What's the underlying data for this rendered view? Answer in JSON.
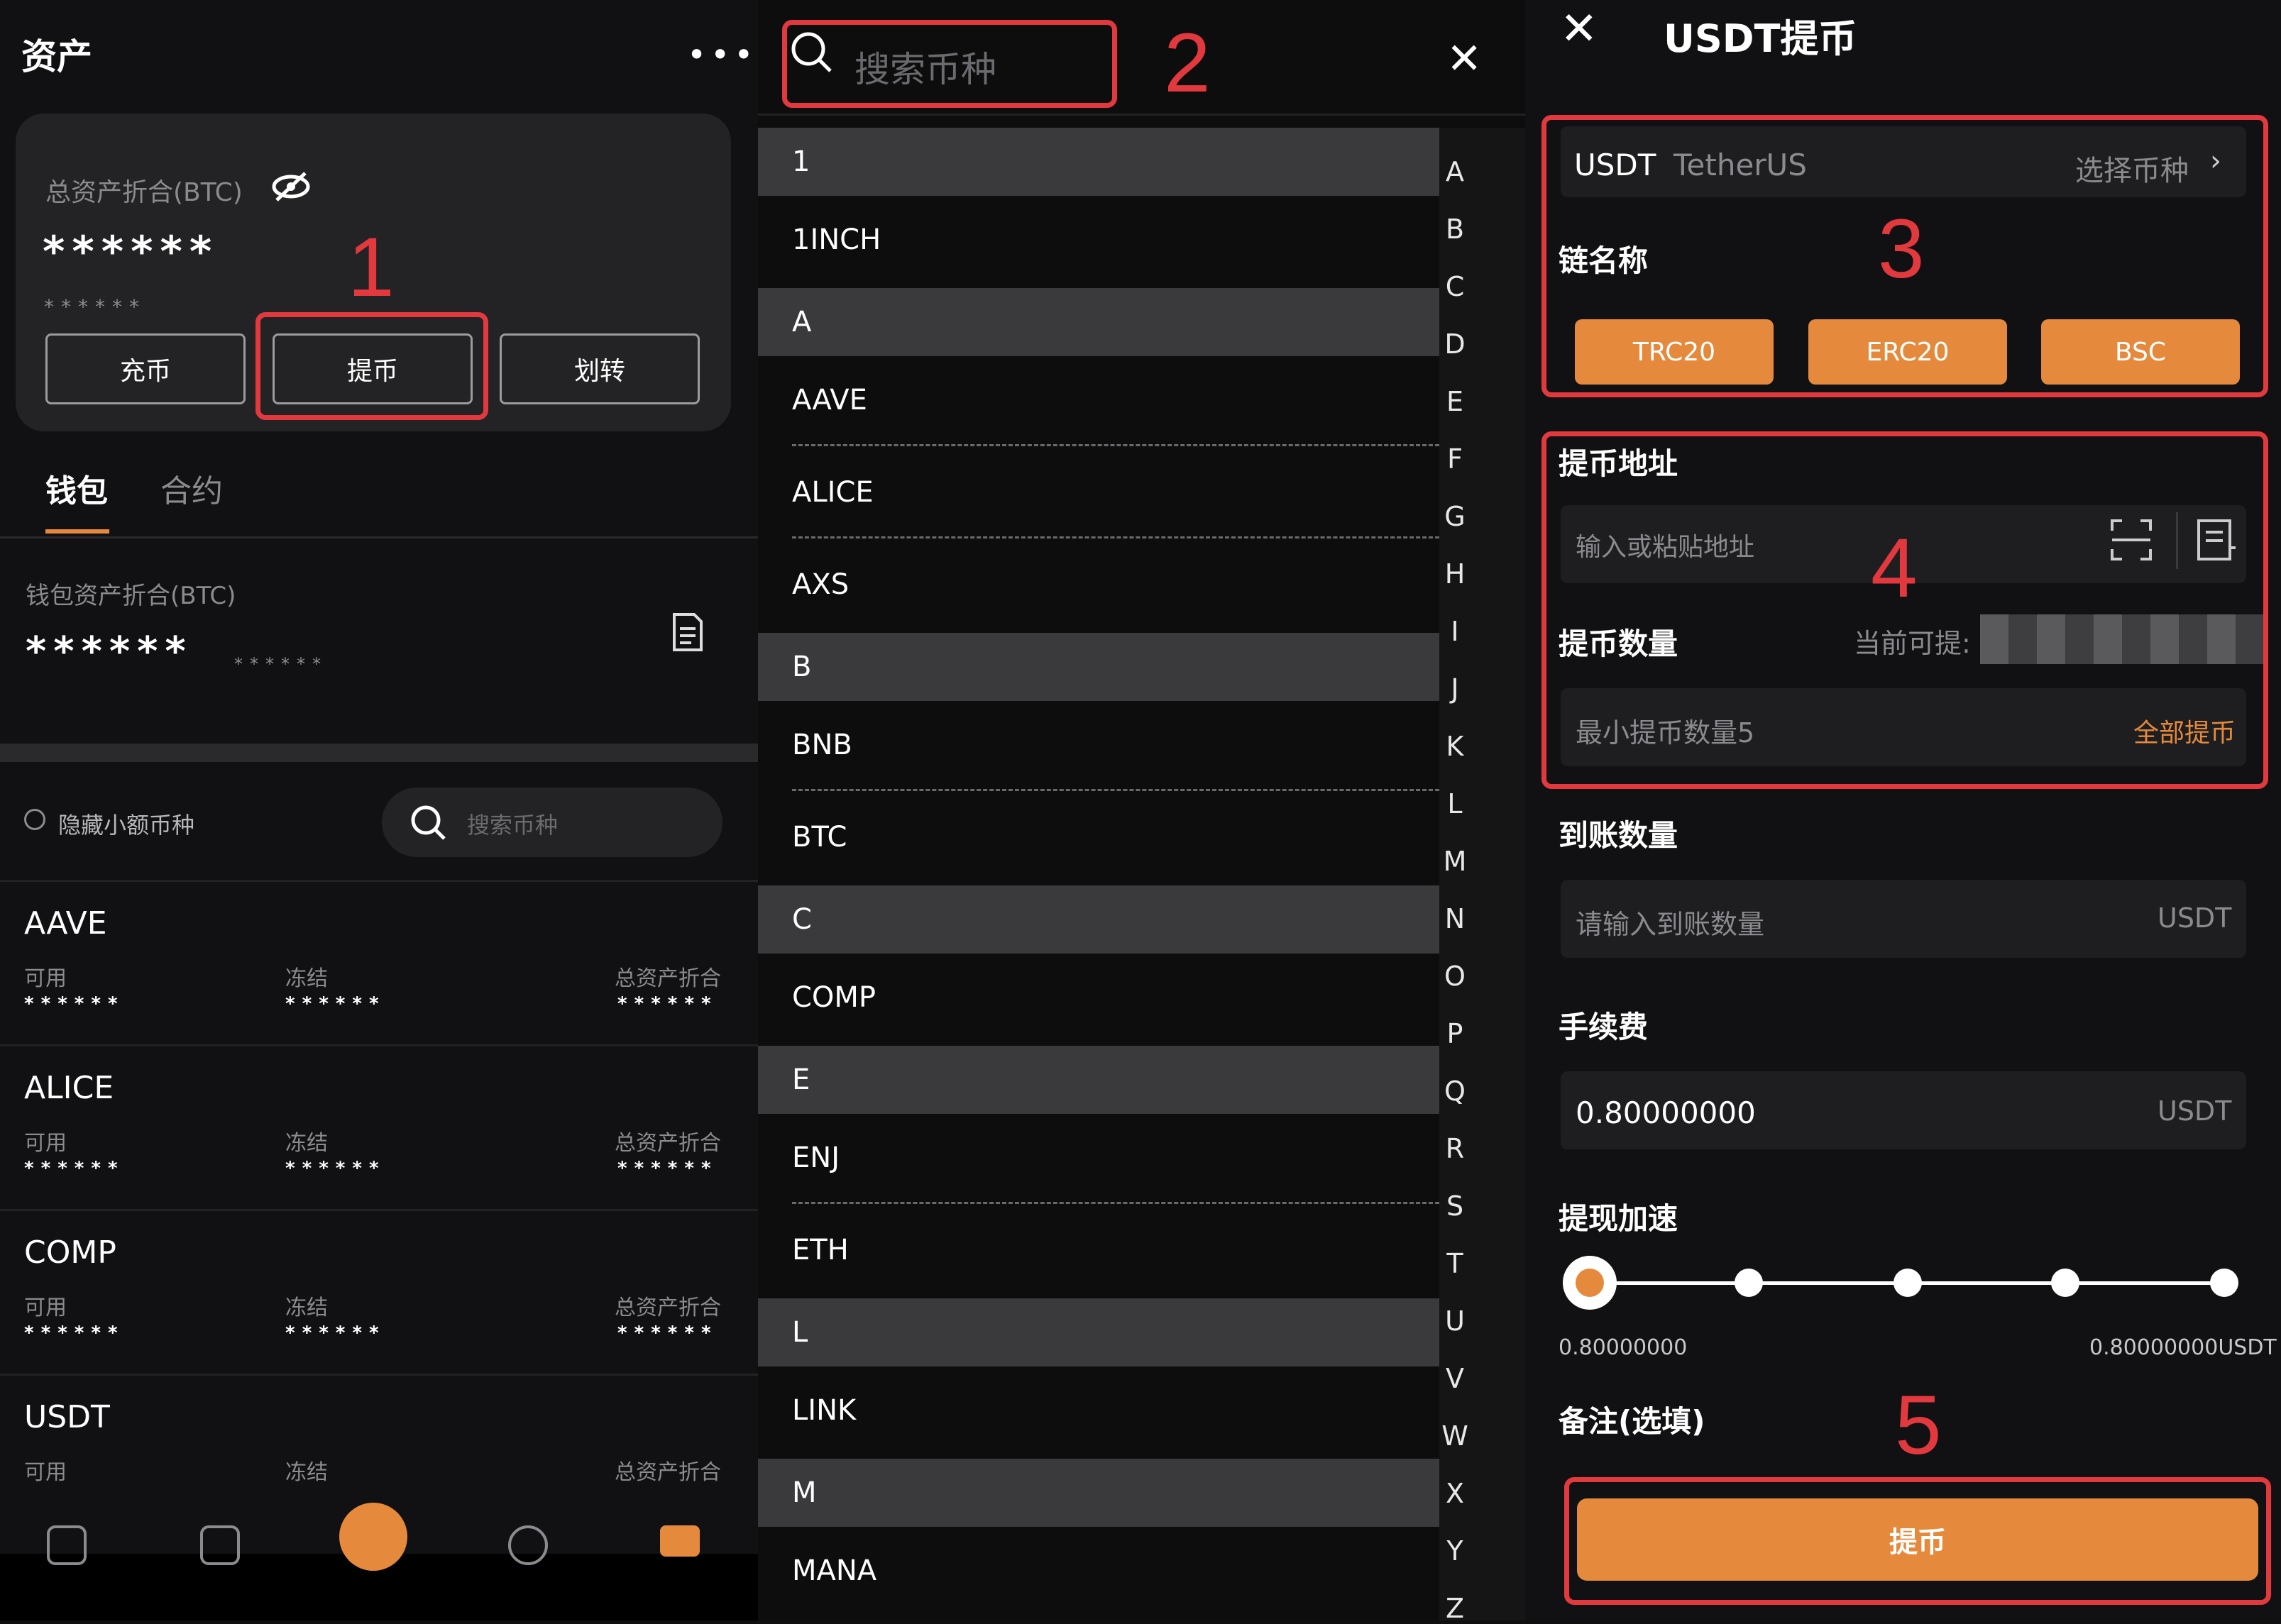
{
  "steps": [
    "1",
    "2",
    "3",
    "4",
    "5"
  ],
  "left": {
    "title": "资产",
    "total_label": "总资产折合(BTC)",
    "total_hidden": "******",
    "total_sub_hidden": "******",
    "buttons": {
      "deposit": "充币",
      "withdraw": "提币",
      "transfer": "划转"
    },
    "tabs": {
      "wallet": "钱包",
      "contract": "合约"
    },
    "wallet_label": "钱包资产折合(BTC)",
    "wallet_hidden": "******",
    "wallet_sub_hidden": "******",
    "hide_small": "隐藏小额币种",
    "search_placeholder": "搜索币种",
    "columns": {
      "available": "可用",
      "frozen": "冻结",
      "total": "总资产折合"
    },
    "assets": [
      {
        "name": "AAVE",
        "available": "******",
        "frozen": "******",
        "total": "******"
      },
      {
        "name": "ALICE",
        "available": "******",
        "frozen": "******",
        "total": "******"
      },
      {
        "name": "COMP",
        "available": "******",
        "frozen": "******",
        "total": "******"
      },
      {
        "name": "USDT",
        "available": "",
        "frozen": "",
        "total": ""
      }
    ]
  },
  "middle": {
    "search_placeholder": "搜索币种",
    "sections": [
      {
        "header": "1",
        "coins": [
          "1INCH"
        ]
      },
      {
        "header": "A",
        "coins": [
          "AAVE",
          "ALICE",
          "AXS"
        ]
      },
      {
        "header": "B",
        "coins": [
          "BNB",
          "BTC"
        ]
      },
      {
        "header": "C",
        "coins": [
          "COMP"
        ]
      },
      {
        "header": "E",
        "coins": [
          "ENJ",
          "ETH"
        ]
      },
      {
        "header": "L",
        "coins": [
          "LINK"
        ]
      },
      {
        "header": "M",
        "coins": [
          "MANA"
        ]
      }
    ],
    "alphabet": [
      "A",
      "B",
      "C",
      "D",
      "E",
      "F",
      "G",
      "H",
      "I",
      "J",
      "K",
      "L",
      "M",
      "N",
      "O",
      "P",
      "Q",
      "R",
      "S",
      "T",
      "U",
      "V",
      "W",
      "X",
      "Y",
      "Z"
    ]
  },
  "right": {
    "title": "USDT提币",
    "coin_symbol": "USDT",
    "coin_name": "TetherUS",
    "select_coin": "选择币种",
    "chain_label": "链名称",
    "chains": [
      "TRC20",
      "ERC20",
      "BSC"
    ],
    "address_label": "提币地址",
    "address_placeholder": "输入或粘贴地址",
    "amount_label": "提币数量",
    "available_prefix": "当前可提:",
    "amount_placeholder": "最小提币数量5",
    "withdraw_all": "全部提币",
    "arrival_label": "到账数量",
    "arrival_placeholder": "请输入到账数量",
    "unit": "USDT",
    "fee_label": "手续费",
    "fee_value": "0.80000000",
    "speed_label": "提现加速",
    "speed_min": "0.80000000",
    "speed_max": "0.80000000USDT",
    "speed_level": 0,
    "memo_label": "备注(选填)",
    "submit": "提币"
  },
  "colors": {
    "accent": "#e58a3c",
    "annotation": "#e2393f"
  }
}
